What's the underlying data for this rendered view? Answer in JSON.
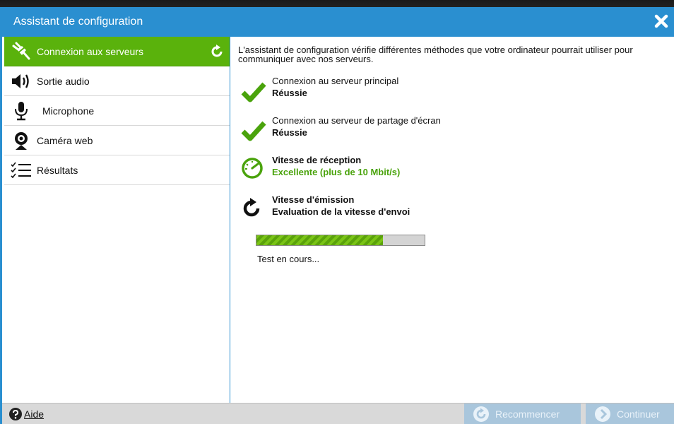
{
  "window": {
    "title": "Assistant de configuration",
    "close_icon": "close-icon"
  },
  "sidebar": {
    "items": [
      {
        "label": "Connexion aux serveurs",
        "icon": "plug-icon",
        "active": true
      },
      {
        "label": "Sortie audio",
        "icon": "speaker-icon",
        "active": false
      },
      {
        "label": "Microphone",
        "icon": "microphone-icon",
        "active": false
      },
      {
        "label": "Caméra web",
        "icon": "webcam-icon",
        "active": false
      },
      {
        "label": "Résultats",
        "icon": "checklist-icon",
        "active": false
      }
    ]
  },
  "main": {
    "intro": "L'assistant de configuration vérifie différentes méthodes que votre ordinateur pourrait utiliser pour communiquer avec nos serveurs.",
    "steps": [
      {
        "title": "Connexion au serveur principal",
        "status": "Réussie",
        "icon": "checkmark-icon"
      },
      {
        "title": "Connexion au serveur de partage d'écran",
        "status": "Réussie",
        "icon": "checkmark-icon"
      },
      {
        "title": "Vitesse de réception",
        "status": "Excellente (plus de 10 Mbit/s)",
        "icon": "speedometer-icon"
      },
      {
        "title": "Vitesse d'émission",
        "status": "Evaluation de la vitesse d'envoi",
        "icon": "loading-icon"
      }
    ],
    "progress": {
      "value": 0.75,
      "label": "Test en cours..."
    }
  },
  "footer": {
    "help_label": "Aide",
    "restart_label": "Recommencer",
    "continue_label": "Continuer"
  },
  "colors": {
    "accent": "#2a8fd0",
    "active_nav": "#5ab20c",
    "success": "#4aa30c",
    "disabled_button": "#a9c6dc"
  }
}
